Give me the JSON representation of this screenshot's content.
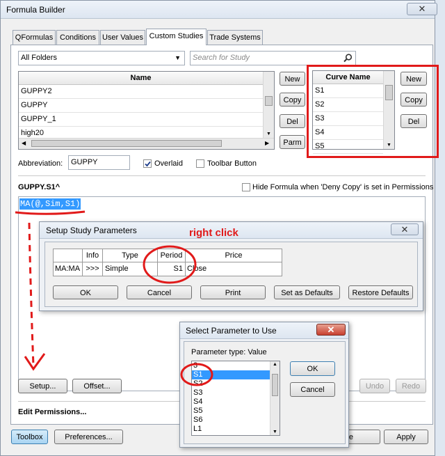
{
  "main_window": {
    "title": "Formula Builder",
    "tabs": [
      {
        "label": "QFormulas"
      },
      {
        "label": "Conditions"
      },
      {
        "label": "User Values"
      },
      {
        "label": "Custom Studies"
      },
      {
        "label": "Trade Systems"
      }
    ],
    "folder_select": "All Folders",
    "search_placeholder": "Search for Study",
    "name_header": "Name",
    "studies": [
      "GUPPY2",
      "GUPPY",
      "GUPPY_1",
      "high20"
    ],
    "study_buttons": {
      "new": "New",
      "copy": "Copy",
      "del": "Del",
      "parm": "Parm"
    },
    "curve_header": "Curve Name",
    "curves": [
      "S1",
      "S2",
      "S3",
      "S4",
      "S5"
    ],
    "curve_buttons": {
      "new": "New",
      "copy": "Copy",
      "del": "Del"
    },
    "abbreviation_label": "Abbreviation:",
    "abbreviation_value": "GUPPY",
    "overlaid_label": "Overlaid",
    "toolbar_button_label": "Toolbar Button",
    "formula_title": "GUPPY.S1^",
    "hide_formula_label": "Hide Formula when 'Deny Copy' is set in Permissions",
    "formula": "MA(@,Sim,S1)",
    "setup_label": "Setup...",
    "offset_label": "Offset...",
    "undo_label": "Undo",
    "redo_label": "Redo",
    "edit_permissions": "Edit Permissions...",
    "toolbox_label": "Toolbox",
    "preferences_label": "Preferences...",
    "close_partial_label": "se",
    "apply_label": "Apply",
    "close_icon": "close-icon"
  },
  "setup_dialog": {
    "title": "Setup Study Parameters",
    "columns": [
      "",
      "Info",
      "Type",
      "Period",
      "Price"
    ],
    "row": [
      "MA:MA",
      ">>>",
      "Simple",
      "S1",
      "Close"
    ],
    "buttons": [
      "OK",
      "Cancel",
      "Print",
      "Set as Defaults",
      "Restore Defaults"
    ]
  },
  "annotation": {
    "text": "right click",
    "color": "#e11a1a"
  },
  "select_dialog": {
    "title": "Select Parameter to Use",
    "param_type": "Parameter type: Value",
    "options": [
      "3",
      "S1",
      "S2",
      "S3",
      "S4",
      "S5",
      "S6",
      "L1"
    ],
    "selected": "S1",
    "ok_label": "OK",
    "cancel_label": "Cancel"
  }
}
